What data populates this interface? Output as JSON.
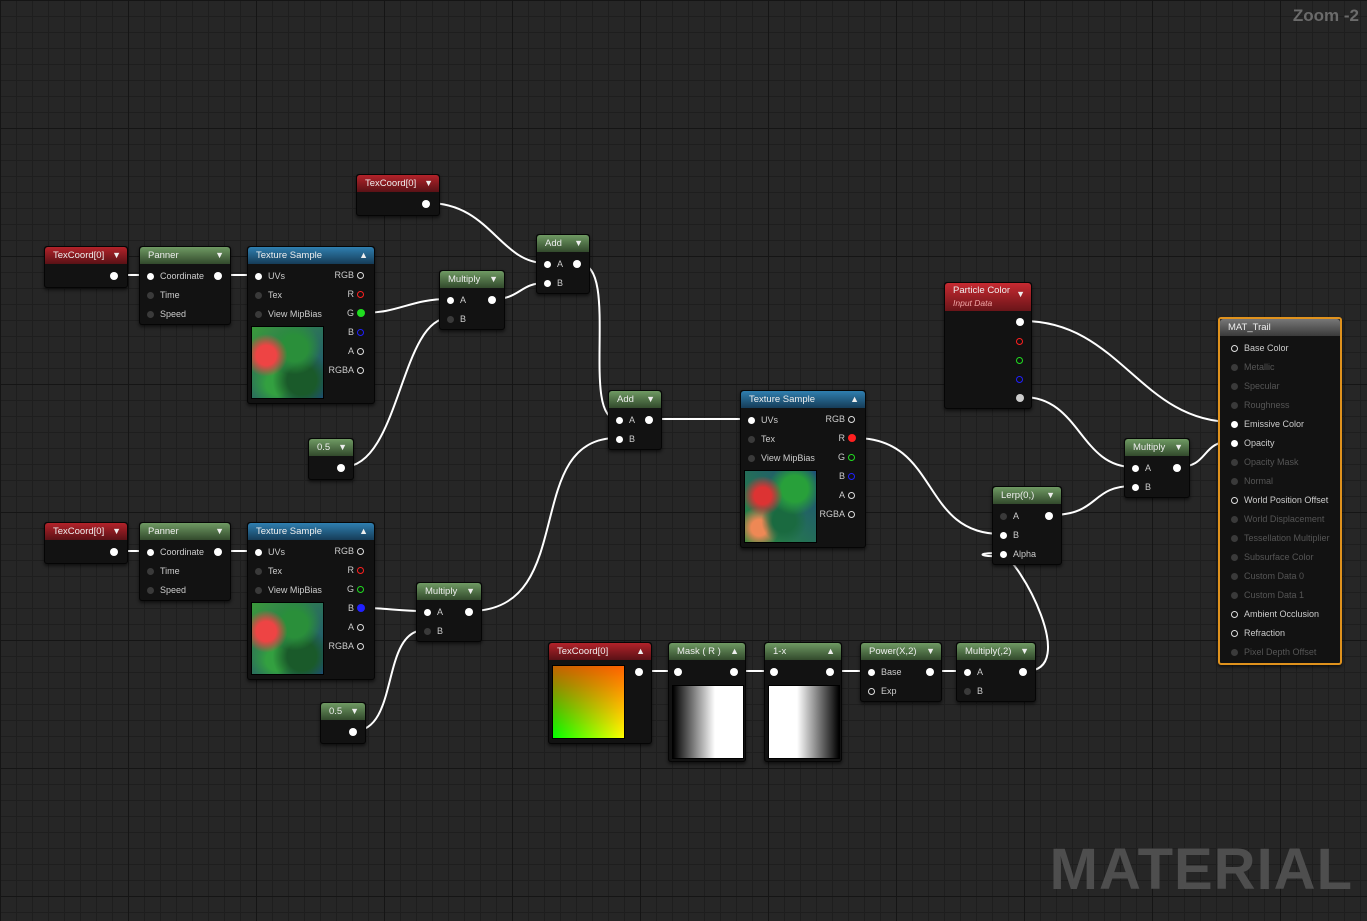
{
  "zoom_label": "Zoom -2",
  "watermark": "MATERIAL",
  "colors": {
    "accent_orange": "#e0921d",
    "wire": "#ffffff",
    "pin_red": "#ff2020",
    "pin_green": "#20dd20",
    "pin_blue": "#2020ff"
  },
  "nodes": {
    "texcoord_top": {
      "title": "TexCoord[0]"
    },
    "texcoord_1": {
      "title": "TexCoord[0]"
    },
    "panner_1": {
      "title": "Panner",
      "pins": [
        "Coordinate",
        "Time",
        "Speed"
      ]
    },
    "texsample_1": {
      "title": "Texture Sample",
      "inputs": [
        "UVs",
        "Tex",
        "View MipBias"
      ],
      "outputs": [
        "RGB",
        "R",
        "G",
        "B",
        "A",
        "RGBA"
      ]
    },
    "multiply_1": {
      "title": "Multiply",
      "pins": [
        "A",
        "B"
      ]
    },
    "const_1": {
      "title": "0.5"
    },
    "add_1": {
      "title": "Add",
      "pins": [
        "A",
        "B"
      ]
    },
    "texcoord_2": {
      "title": "TexCoord[0]"
    },
    "panner_2": {
      "title": "Panner",
      "pins": [
        "Coordinate",
        "Time",
        "Speed"
      ]
    },
    "texsample_2": {
      "title": "Texture Sample",
      "inputs": [
        "UVs",
        "Tex",
        "View MipBias"
      ],
      "outputs": [
        "RGB",
        "R",
        "G",
        "B",
        "A",
        "RGBA"
      ]
    },
    "multiply_2": {
      "title": "Multiply",
      "pins": [
        "A",
        "B"
      ]
    },
    "const_2": {
      "title": "0.5"
    },
    "add_2": {
      "title": "Add",
      "pins": [
        "A",
        "B"
      ]
    },
    "texsample_3": {
      "title": "Texture Sample",
      "inputs": [
        "UVs",
        "Tex",
        "View MipBias"
      ],
      "outputs": [
        "RGB",
        "R",
        "G",
        "B",
        "A",
        "RGBA"
      ]
    },
    "particle_color": {
      "title": "Particle Color",
      "subtitle": "Input Data"
    },
    "lerp": {
      "title": "Lerp(0,)",
      "pins": [
        "A",
        "B",
        "Alpha"
      ]
    },
    "multiply_3": {
      "title": "Multiply",
      "pins": [
        "A",
        "B"
      ]
    },
    "texcoord_3": {
      "title": "TexCoord[0]"
    },
    "mask_r": {
      "title": "Mask ( R )"
    },
    "one_minus": {
      "title": "1-x"
    },
    "power": {
      "title": "Power(X,2)",
      "pins": [
        "Base",
        "Exp"
      ]
    },
    "multiply_4": {
      "title": "Multiply(,2)",
      "pins": [
        "A",
        "B"
      ]
    },
    "mat_trail": {
      "title": "MAT_Trail",
      "pins": [
        "Base Color",
        "Metallic",
        "Specular",
        "Roughness",
        "Emissive Color",
        "Opacity",
        "Opacity Mask",
        "Normal",
        "World Position Offset",
        "World Displacement",
        "Tessellation Multiplier",
        "Subsurface Color",
        "Custom Data 0",
        "Custom Data 1",
        "Ambient Occlusion",
        "Refraction",
        "Pixel Depth Offset"
      ]
    }
  }
}
